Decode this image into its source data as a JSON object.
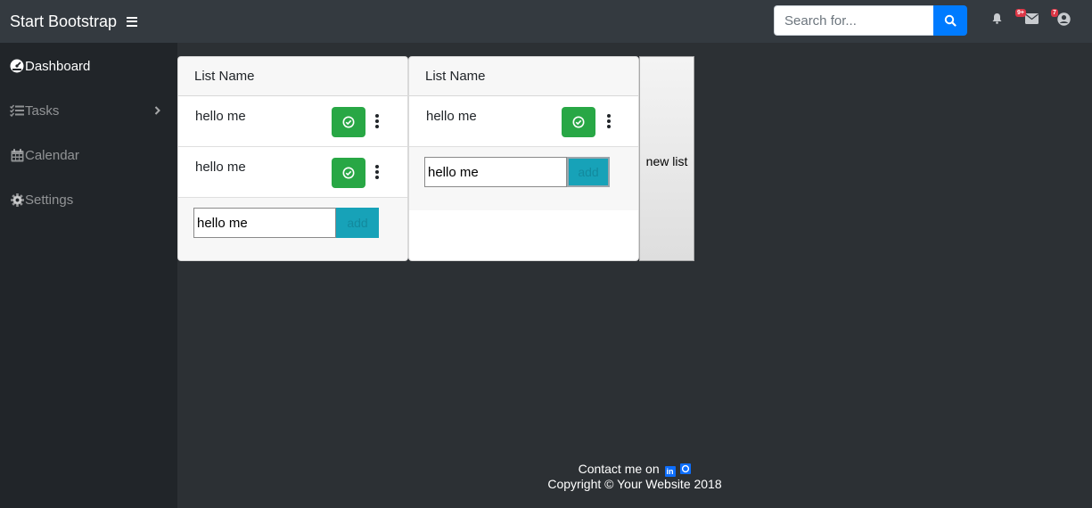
{
  "topbar": {
    "brand": "Start Bootstrap",
    "search_placeholder": "Search for...",
    "alerts_badge": "",
    "messages_badge": "9+",
    "user_badge": "7"
  },
  "sidebar": {
    "items": [
      {
        "label": "Dashboard",
        "icon": "dashboard-icon",
        "active": true
      },
      {
        "label": "Tasks",
        "icon": "tasks-icon",
        "active": false
      },
      {
        "label": "Calendar",
        "icon": "calendar-icon",
        "active": false
      },
      {
        "label": "Settings",
        "icon": "settings-icon",
        "active": false
      }
    ]
  },
  "lists": [
    {
      "title": "List Name",
      "items": [
        "hello me",
        "hello me"
      ],
      "input_value": "hello me",
      "add_label": "add"
    },
    {
      "title": "List Name",
      "items": [
        "hello me"
      ],
      "input_value": "hello me",
      "add_label": "add"
    }
  ],
  "new_list_label": "new list",
  "footer": {
    "contact": "Contact me on",
    "copyright": "Copyright © Your Website 2018"
  },
  "colors": {
    "topbar": "#343a40",
    "sidebar": "#212529",
    "content": "#2c3034",
    "primary": "#007bff",
    "success": "#28a745",
    "info": "#17a2b8"
  }
}
